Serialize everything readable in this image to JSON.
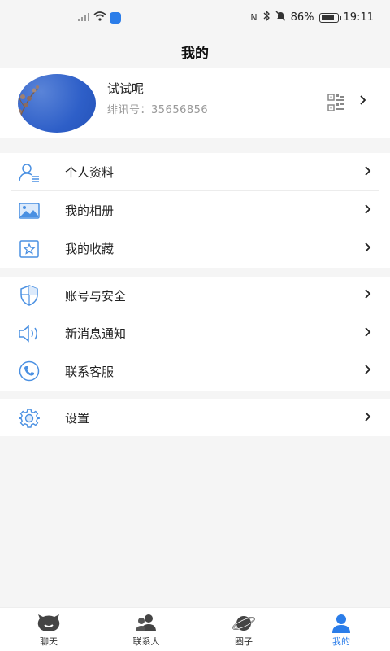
{
  "status_bar": {
    "battery_percent": "86%",
    "time": "19:11",
    "nfc": "N",
    "mute": "✖"
  },
  "header": {
    "title": "我的"
  },
  "profile": {
    "name": "试试呢",
    "id_label": "绯讯号：",
    "id_value": "35656856"
  },
  "menu_group_1": [
    {
      "label": "个人资料",
      "icon": "person-list-icon"
    },
    {
      "label": "我的相册",
      "icon": "photo-album-icon"
    },
    {
      "label": "我的收藏",
      "icon": "star-frame-icon"
    }
  ],
  "menu_group_2": [
    {
      "label": "账号与安全",
      "icon": "shield-icon"
    },
    {
      "label": "新消息通知",
      "icon": "speaker-icon"
    },
    {
      "label": "联系客服",
      "icon": "phone-icon"
    }
  ],
  "menu_group_3": [
    {
      "label": "设置",
      "icon": "gear-icon"
    }
  ],
  "bottom_nav": [
    {
      "label": "聊天",
      "icon": "chat-face-icon",
      "active": false
    },
    {
      "label": "联系人",
      "icon": "contacts-icon",
      "active": false
    },
    {
      "label": "圈子",
      "icon": "planet-icon",
      "active": false
    },
    {
      "label": "我的",
      "icon": "user-icon",
      "active": true
    }
  ],
  "colors": {
    "accent": "#2b7de9",
    "icon_blue": "#4a90e2",
    "background": "#f5f5f5"
  }
}
